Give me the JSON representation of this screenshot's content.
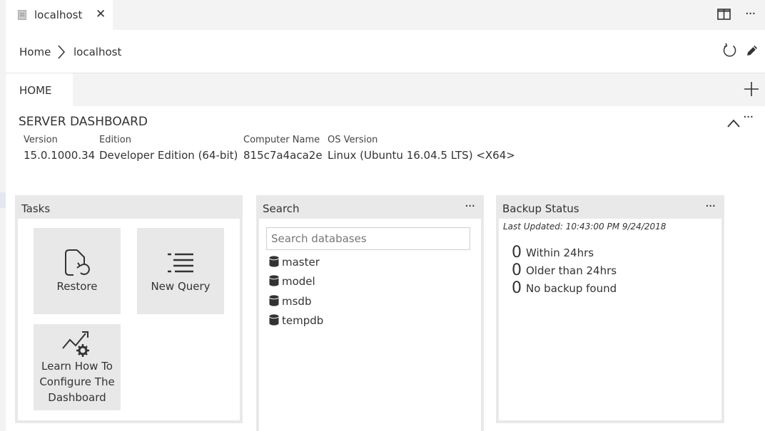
{
  "tab": {
    "title": "localhost",
    "close": "✕"
  },
  "toolbar": {
    "more": "···"
  },
  "breadcrumb": {
    "home": "Home",
    "current": "localhost"
  },
  "dashboard_tabs": [
    {
      "label": "HOME"
    }
  ],
  "server_dashboard": {
    "title": "SERVER DASHBOARD",
    "more": "···",
    "properties": [
      {
        "key": "Version",
        "value": "15.0.1000.34"
      },
      {
        "key": "Edition",
        "value": "Developer Edition (64-bit)"
      },
      {
        "key": "Computer Name",
        "value": "815c7a4aca2e"
      },
      {
        "key": "OS Version",
        "value": "Linux (Ubuntu 16.04.5 LTS) <X64>"
      }
    ]
  },
  "widgets": {
    "tasks": {
      "title": "Tasks",
      "items": [
        {
          "label": "Restore",
          "icon": "restore-icon"
        },
        {
          "label": "New Query",
          "icon": "new-query-icon"
        },
        {
          "label_lines": [
            "Learn How To",
            "Configure The",
            "Dashboard"
          ],
          "icon": "configure-dashboard-icon"
        }
      ]
    },
    "search": {
      "title": "Search",
      "more": "···",
      "placeholder": "Search databases",
      "databases": [
        "master",
        "model",
        "msdb",
        "tempdb"
      ]
    },
    "backup": {
      "title": "Backup Status",
      "more": "···",
      "last_updated": "Last Updated: 10:43:00 PM 9/24/2018",
      "rows": [
        {
          "count": "0",
          "label": "Within 24hrs"
        },
        {
          "count": "0",
          "label": "Older than 24hrs"
        },
        {
          "count": "0",
          "label": "No backup found"
        }
      ]
    }
  }
}
